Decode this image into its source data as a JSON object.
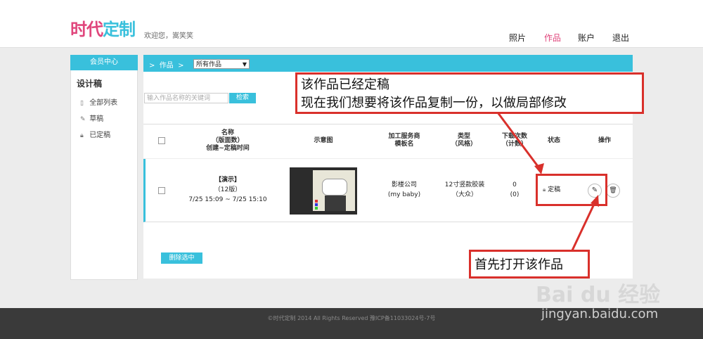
{
  "header": {
    "logo": {
      "part1": "时代",
      "part2": "定制"
    },
    "welcome": "欢迎您，嵩笑笑",
    "nav": [
      "照片",
      "作品",
      "账户",
      "退出"
    ],
    "active_nav": "作品"
  },
  "sidebar": {
    "header": "会员中心",
    "section_title": "设计稿",
    "items": [
      "全部列表",
      "草稿",
      "已定稿"
    ]
  },
  "breadcrumb": {
    "label": "作品",
    "select_value": "所有作品"
  },
  "search": {
    "placeholder": "输入作品名称的关键词",
    "button": "检索"
  },
  "table": {
    "headers": {
      "name": [
        "名称",
        "（版面数）",
        "创建~定稿时间"
      ],
      "preview": "示意图",
      "vendor": [
        "加工服务商",
        "模板名"
      ],
      "type": [
        "类型",
        "（风格）"
      ],
      "downloads": [
        "下载次数",
        "（计数）"
      ],
      "status": "状态",
      "actions": "操作"
    },
    "rows": [
      {
        "name": "【演示】",
        "pages": "（12版）",
        "time": "7/25 15:09 ~ 7/25 15:10",
        "vendor": "影楼公司",
        "template": "(my baby)",
        "type": "12寸竖款胶装",
        "style": "（大众）",
        "downloads": "0",
        "count": "(0)",
        "status": "定稿"
      }
    ]
  },
  "delete_button": "删除选中",
  "footer": "©时代定制 2014 All Rights Reserved  豫ICP备11033024号-7号",
  "annotations": {
    "box1": [
      "该作品已经定稿",
      "现在我们想要将该作品复制一份，以做局部修改"
    ],
    "box2": "首先打开该作品"
  },
  "watermark": {
    "brand": "Bai du 经验",
    "url": "jingyan.baidu.com"
  },
  "colors": {
    "accent": "#39c0dc",
    "brand_pink": "#e0467c",
    "annotation_red": "#d9302b"
  }
}
